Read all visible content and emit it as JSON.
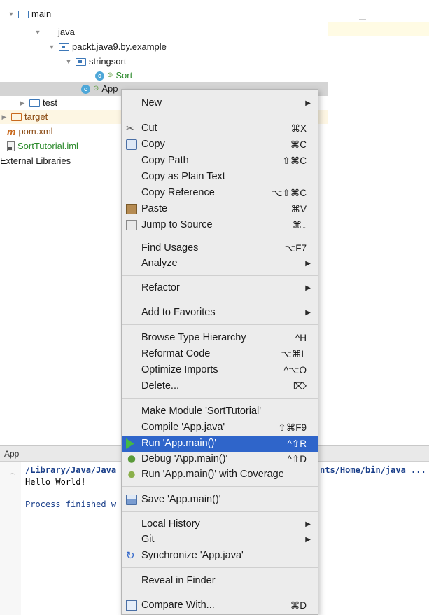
{
  "tree": {
    "items": [
      {
        "label": "main",
        "icon": "folder-icon",
        "type": "folder"
      },
      {
        "label": "java",
        "icon": "source-folder-icon",
        "type": "folder"
      },
      {
        "label": "packt.java9.by.example",
        "icon": "package-icon",
        "type": "package"
      },
      {
        "label": "stringsort",
        "icon": "package-icon",
        "type": "package"
      },
      {
        "label": "Sort",
        "icon": "class-icon",
        "type": "class"
      },
      {
        "label": "App",
        "icon": "class-icon",
        "type": "class"
      },
      {
        "label": "test",
        "icon": "folder-icon",
        "type": "folder"
      },
      {
        "label": "target",
        "icon": "folder-icon",
        "type": "folder"
      },
      {
        "label": "pom.xml",
        "icon": "maven-icon",
        "type": "file"
      },
      {
        "label": "SortTutorial.iml",
        "icon": "iml-file-icon",
        "type": "file"
      },
      {
        "label": "External Libraries",
        "icon": "",
        "type": "node"
      }
    ]
  },
  "run_panel": {
    "title": "App",
    "lines": {
      "cmd_start": "/Library/Java/Java",
      "cmd_end": "nts/Home/bin/java ...",
      "output": "Hello World!",
      "process": "Process finished w"
    }
  },
  "menu": {
    "items": [
      {
        "label": "New",
        "shortcut": "",
        "submenu": true
      },
      {
        "label": "Cut",
        "shortcut": "⌘X",
        "icon": "scissors-icon"
      },
      {
        "label": "Copy",
        "shortcut": "⌘C",
        "icon": "copy-icon"
      },
      {
        "label": "Copy Path",
        "shortcut": "⇧⌘C"
      },
      {
        "label": "Copy as Plain Text",
        "shortcut": ""
      },
      {
        "label": "Copy Reference",
        "shortcut": "⌥⇧⌘C"
      },
      {
        "label": "Paste",
        "shortcut": "⌘V",
        "icon": "paste-icon"
      },
      {
        "label": "Jump to Source",
        "shortcut": "⌘↓",
        "icon": "jump-to-source-icon"
      },
      {
        "label": "Find Usages",
        "shortcut": "⌥F7"
      },
      {
        "label": "Analyze",
        "shortcut": "",
        "submenu": true
      },
      {
        "label": "Refactor",
        "shortcut": "",
        "submenu": true
      },
      {
        "label": "Add to Favorites",
        "shortcut": "",
        "submenu": true
      },
      {
        "label": "Browse Type Hierarchy",
        "shortcut": "^H"
      },
      {
        "label": "Reformat Code",
        "shortcut": "⌥⌘L"
      },
      {
        "label": "Optimize Imports",
        "shortcut": "^⌥O"
      },
      {
        "label": "Delete...",
        "shortcut": "⌦"
      },
      {
        "label": "Make Module 'SortTutorial'",
        "shortcut": ""
      },
      {
        "label": "Compile 'App.java'",
        "shortcut": "⇧⌘F9"
      },
      {
        "label": "Run 'App.main()'",
        "shortcut": "^⇧R",
        "icon": "run-icon",
        "highlighted": true
      },
      {
        "label": "Debug 'App.main()'",
        "shortcut": "^⇧D",
        "icon": "debug-icon"
      },
      {
        "label": "Run 'App.main()' with Coverage",
        "shortcut": "",
        "icon": "coverage-icon"
      },
      {
        "label": "Save 'App.main()'",
        "shortcut": "",
        "icon": "save-icon"
      },
      {
        "label": "Local History",
        "shortcut": "",
        "submenu": true
      },
      {
        "label": "Git",
        "shortcut": "",
        "submenu": true
      },
      {
        "label": "Synchronize 'App.java'",
        "shortcut": "",
        "icon": "sync-icon"
      },
      {
        "label": "Reveal in Finder",
        "shortcut": ""
      },
      {
        "label": "Compare With...",
        "shortcut": "⌘D",
        "icon": "compare-icon"
      }
    ]
  },
  "colors": {
    "highlight": "#2f65ca",
    "menu_bg": "#ececec",
    "selection_row": "#d4d4d4"
  }
}
